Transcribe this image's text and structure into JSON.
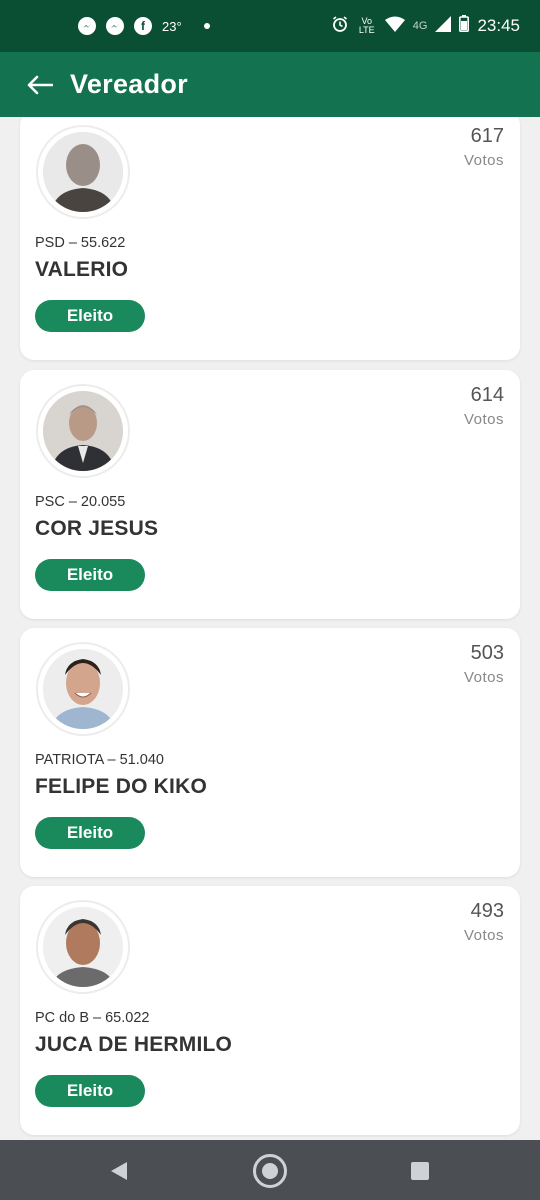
{
  "status_bar": {
    "temperature": "23°",
    "network": "4G",
    "volte": "Vo LTE",
    "time": "23:45"
  },
  "app_bar": {
    "title": "Vereador"
  },
  "candidates": [
    {
      "party_number": "PSD – 55.622",
      "name": "VALERIO",
      "votes": "617",
      "votes_label": "Votos",
      "status": "Eleito"
    },
    {
      "party_number": "PSC – 20.055",
      "name": "COR JESUS",
      "votes": "614",
      "votes_label": "Votos",
      "status": "Eleito"
    },
    {
      "party_number": "PATRIOTA – 51.040",
      "name": "FELIPE DO KIKO",
      "votes": "503",
      "votes_label": "Votos",
      "status": "Eleito"
    },
    {
      "party_number": "PC do B – 65.022",
      "name": "JUCA DE HERMILO",
      "votes": "493",
      "votes_label": "Votos",
      "status": "Eleito"
    }
  ],
  "colors": {
    "status_bar": "#0a4f34",
    "app_bar": "#137351",
    "pill": "#1a8a5c",
    "nav_bar": "#4b4f54"
  }
}
